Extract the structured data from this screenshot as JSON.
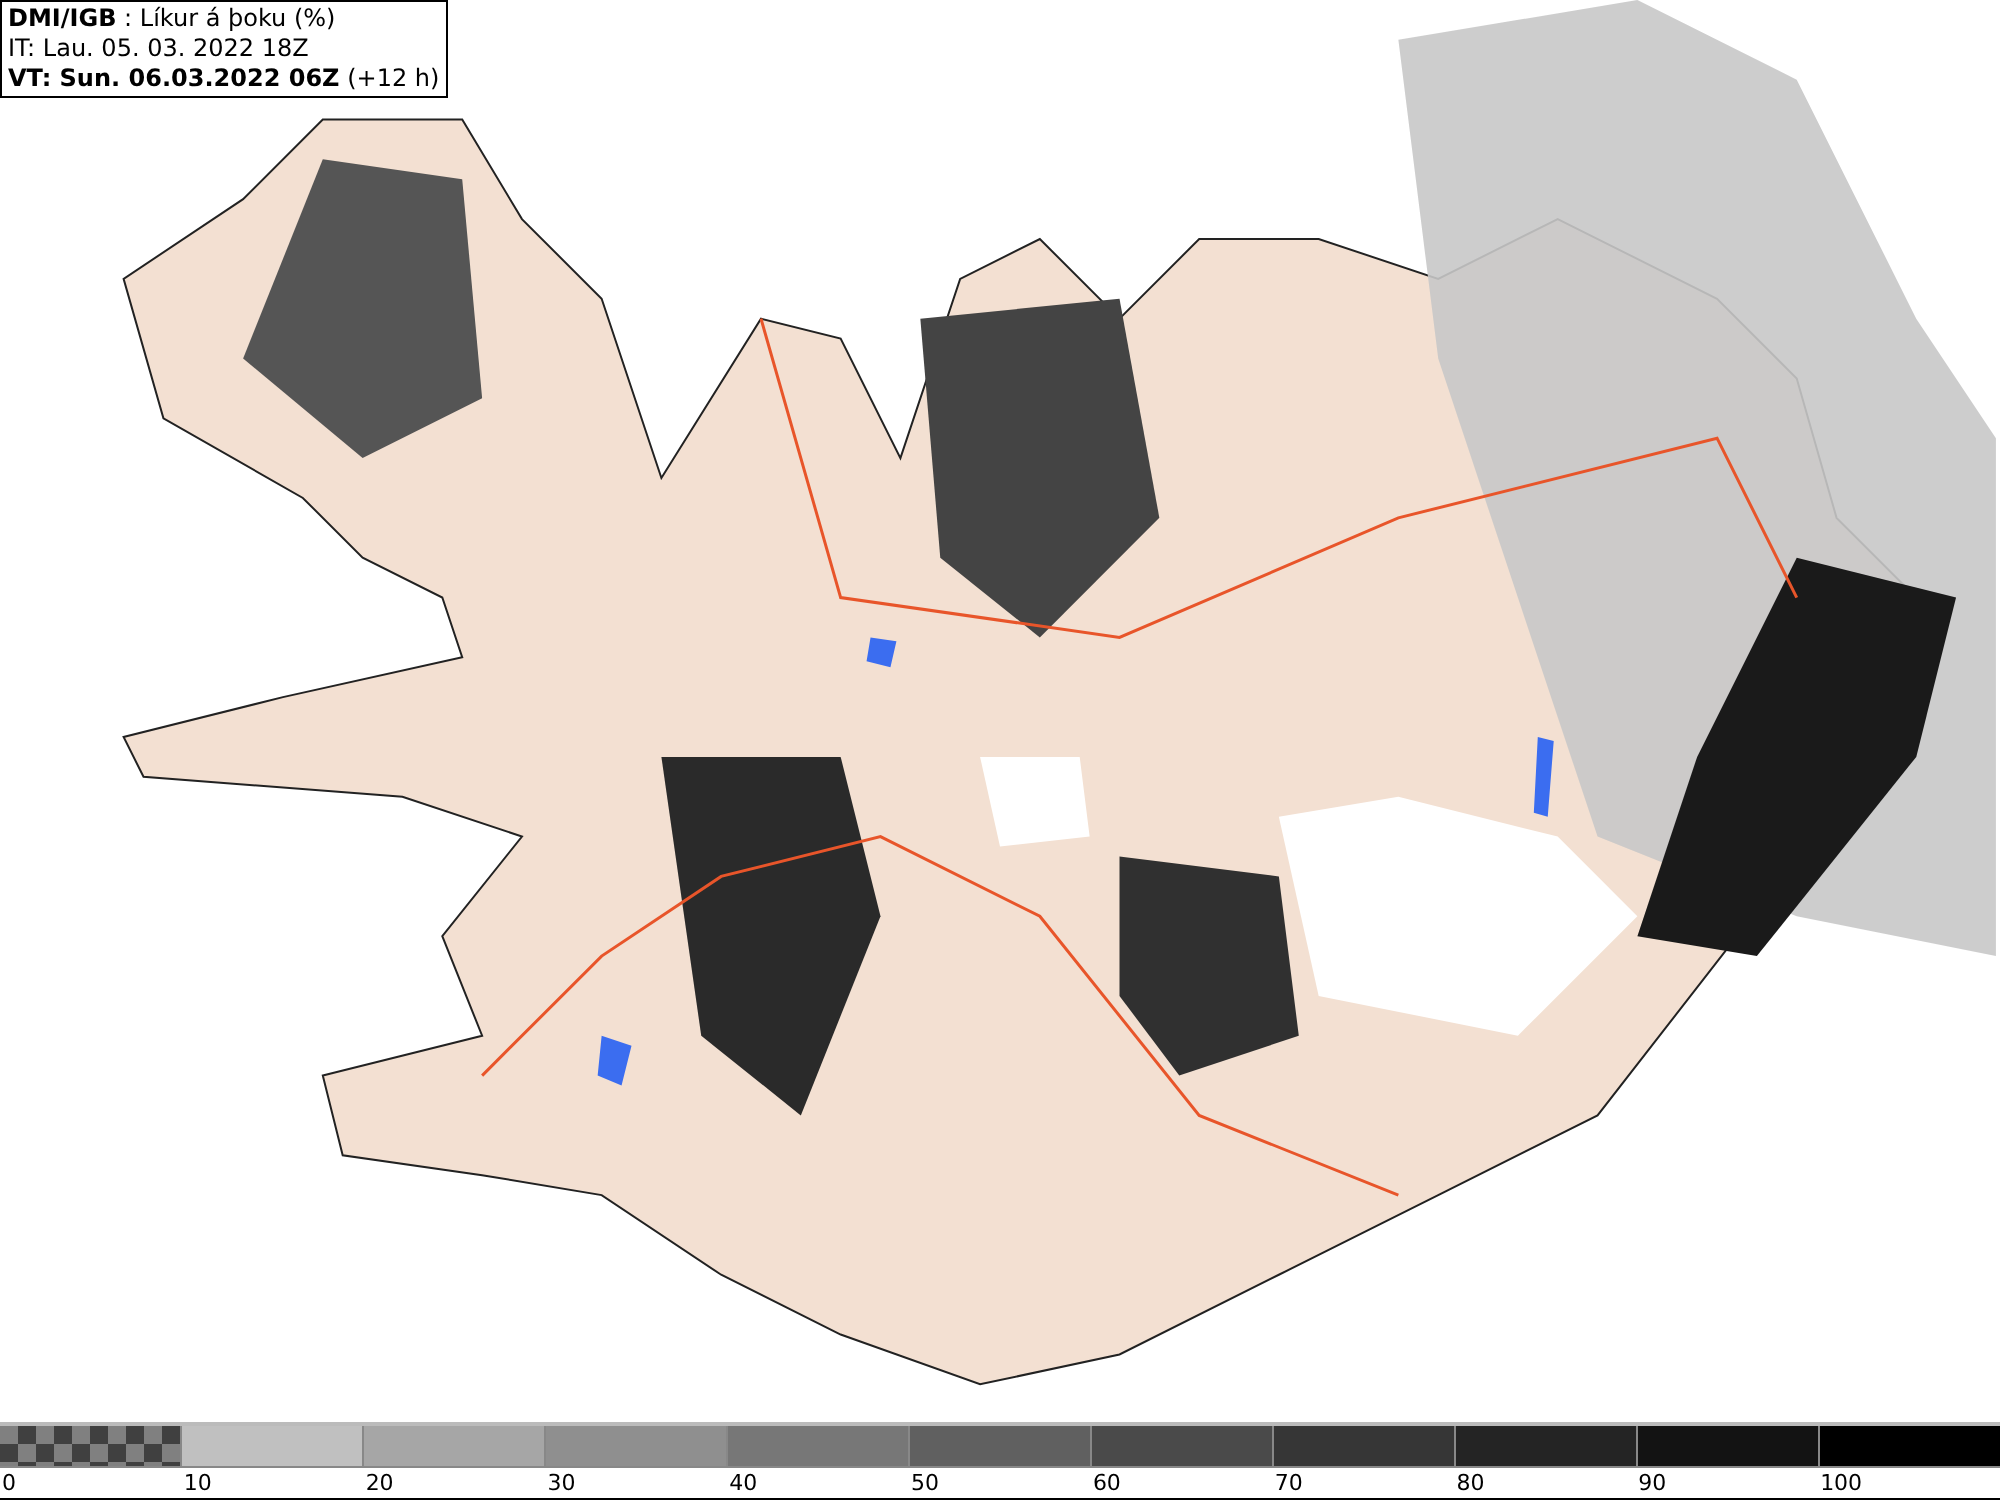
{
  "header": {
    "source": "DMI/IGB",
    "title": " : Líkur á þoku (%)",
    "issue_time": "IT: Lau. 05. 03. 2022 18Z",
    "valid_time": "VT: Sun. 06.03.2022 06Z",
    "lead": "(+12 h)"
  },
  "legend": {
    "segments": [
      {
        "kind": "checker",
        "color": "#808080"
      },
      {
        "kind": "solid",
        "color": "#c0c0c0"
      },
      {
        "kind": "solid",
        "color": "#a6a6a6"
      },
      {
        "kind": "solid",
        "color": "#8f8f8f"
      },
      {
        "kind": "solid",
        "color": "#777777"
      },
      {
        "kind": "solid",
        "color": "#606060"
      },
      {
        "kind": "solid",
        "color": "#4a4a4a"
      },
      {
        "kind": "solid",
        "color": "#363636"
      },
      {
        "kind": "solid",
        "color": "#242424"
      },
      {
        "kind": "solid",
        "color": "#131313"
      },
      {
        "kind": "solid",
        "color": "#000000"
      }
    ],
    "labels": [
      "0",
      "10",
      "20",
      "30",
      "40",
      "50",
      "60",
      "70",
      "80",
      "90",
      "100"
    ]
  }
}
